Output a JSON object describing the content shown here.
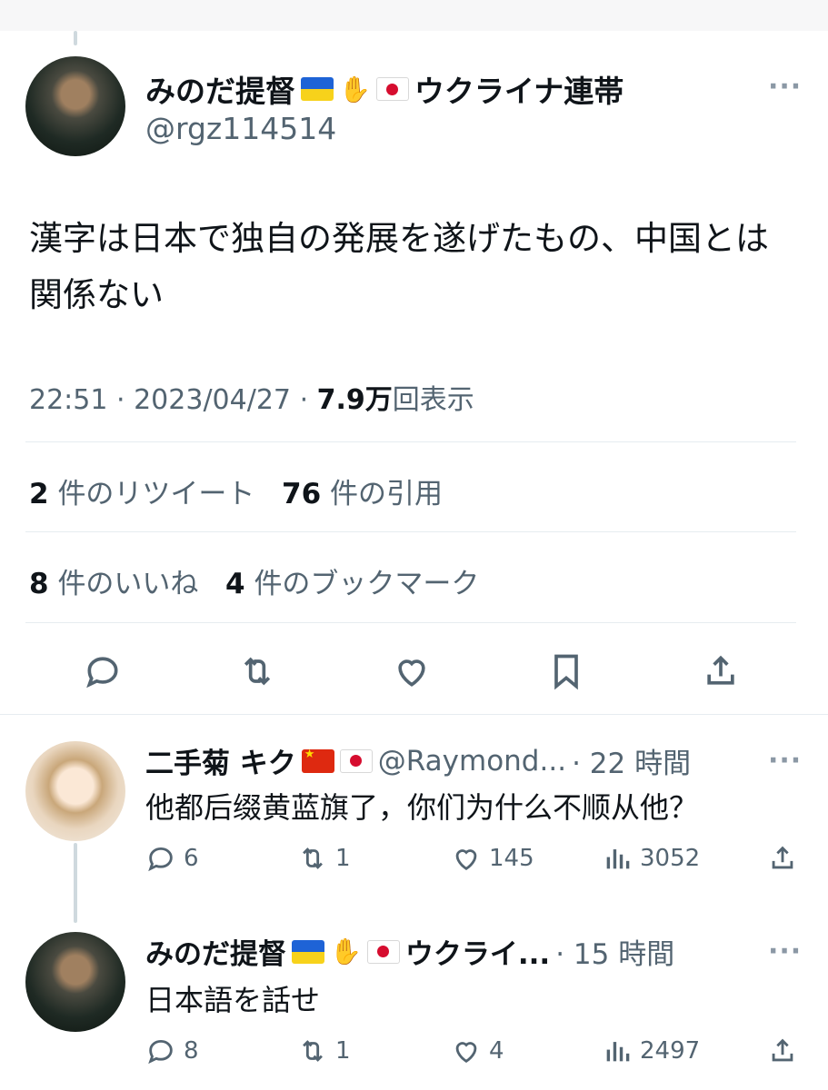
{
  "main_tweet": {
    "display_name": "みのだ提督",
    "name_suffix": "ウクライナ連帯",
    "handle": "@rgz114514",
    "text": "漢字は日本で独自の発展を遂げたもの、中国とは関係ない",
    "time": "22:51",
    "date": "2023/04/27",
    "views_number": "7.9",
    "views_unit": "万",
    "views_label": "回表示",
    "retweets_count": "2",
    "retweets_label": "件のリツイート",
    "quotes_count": "76",
    "quotes_label": "件の引用",
    "likes_count": "8",
    "likes_label": "件のいいね",
    "bookmarks_count": "4",
    "bookmarks_label": "件のブックマーク",
    "more": "···"
  },
  "replies": [
    {
      "display_name": "二手菊 キク",
      "handle": "@Raymond...",
      "time": "· 22 時間",
      "text": "他都后缀黄蓝旗了，你们为什么不顺从他？",
      "reply_count": "6",
      "retweet_count": "1",
      "like_count": "145",
      "view_count": "3052",
      "more": "···"
    },
    {
      "display_name": "みのだ提督",
      "name_suffix": "ウクライ...",
      "time": "· 15 時間",
      "text": "日本語を話せ",
      "reply_count": "8",
      "retweet_count": "1",
      "like_count": "4",
      "view_count": "2497",
      "more": "···"
    }
  ],
  "colors": {
    "text": "#0f1419",
    "secondary": "#536471",
    "divider": "#e6ecf0"
  },
  "icons": [
    "reply-icon",
    "retweet-icon",
    "like-icon",
    "bookmark-icon",
    "share-icon",
    "views-icon"
  ]
}
